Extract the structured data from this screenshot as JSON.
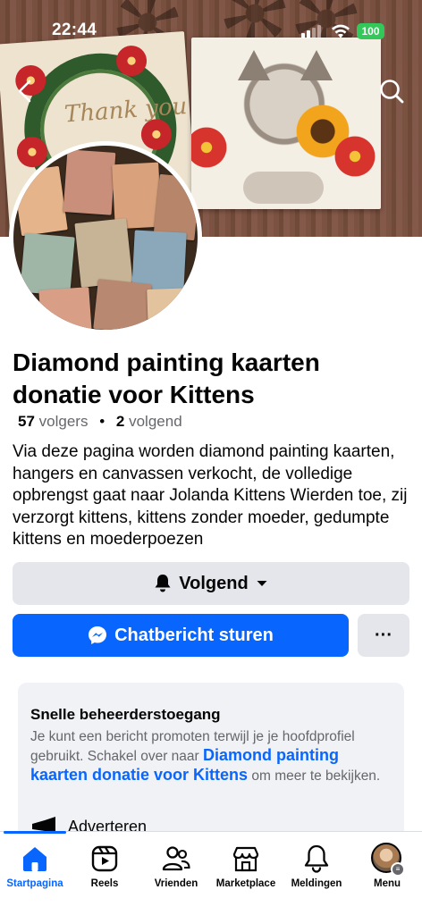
{
  "status": {
    "time": "22:44",
    "battery": "100"
  },
  "cover": {
    "card_text": "Thank you"
  },
  "page": {
    "title": "Diamond painting kaarten donatie voor Kittens",
    "followers_count": "57",
    "followers_label": "volgers",
    "separator": "•",
    "following_count": "2",
    "following_label": "volgend",
    "description": "Via deze pagina worden diamond painting kaarten, hangers en canvassen verkocht, de volledige opbrengst gaat naar Jolanda Kittens Wierden toe, zij verzorgt kittens, kittens zonder moeder, gedumpte kittens en moederpoezen"
  },
  "actions": {
    "follow_label": "Volgend",
    "chat_label": "Chatbericht sturen",
    "more_label": "···"
  },
  "admin": {
    "title": "Snelle beheerderstoegang",
    "text_before": "Je kunt een bericht promoten terwijl je je hoofdprofiel gebruikt. Schakel over naar ",
    "link": "Diamond painting kaarten donatie voor Kittens",
    "text_after": " om meer te bekijken.",
    "advertise_label": "Adverteren"
  },
  "tabs": [
    {
      "label": "Startpagina",
      "icon": "home-icon",
      "active": true
    },
    {
      "label": "Reels",
      "icon": "reels-icon",
      "active": false
    },
    {
      "label": "Vrienden",
      "icon": "friends-icon",
      "active": false
    },
    {
      "label": "Marketplace",
      "icon": "marketplace-icon",
      "active": false
    },
    {
      "label": "Meldingen",
      "icon": "bell-icon",
      "active": false
    },
    {
      "label": "Menu",
      "icon": "profile-avatar",
      "active": false
    }
  ],
  "colors": {
    "accent": "#0866ff",
    "button_gray": "#e4e6eb",
    "battery": "#34c759"
  }
}
